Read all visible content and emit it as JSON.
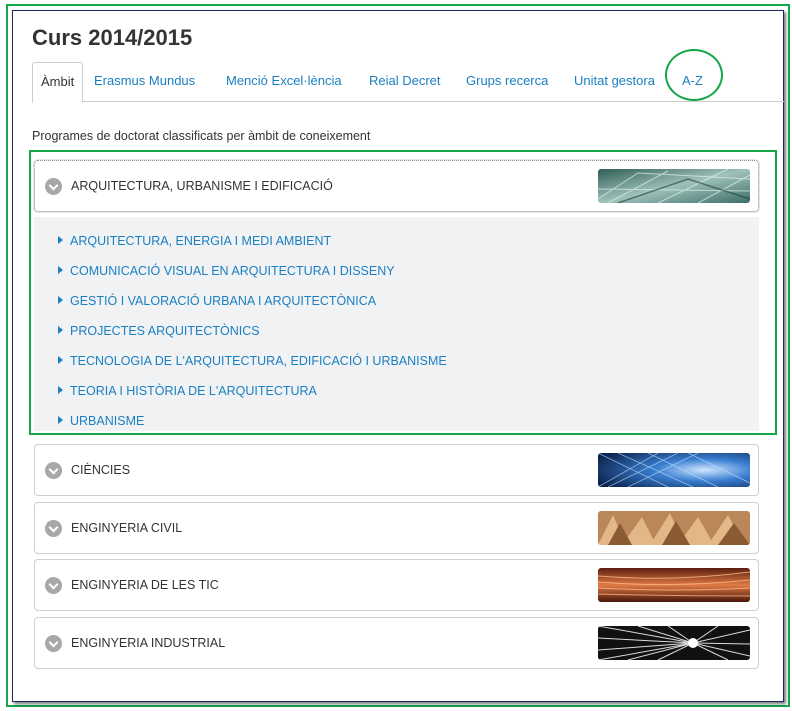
{
  "page": {
    "title": "Curs 2014/2015"
  },
  "tabs": [
    {
      "label": "Àmbit",
      "active": true
    },
    {
      "label": "Erasmus Mundus"
    },
    {
      "label": "Menció Excel·lència"
    },
    {
      "label": "Reial Decret"
    },
    {
      "label": "Grups recerca"
    },
    {
      "label": "Unitat gestora"
    },
    {
      "label": "A-Z"
    }
  ],
  "intro": "Programes de doctorat classificats per àmbit de coneixement",
  "areas": [
    {
      "label": "ARQUITECTURA, URBANISME I EDIFICACIÓ",
      "expanded": true,
      "thumb_icon": "architecture-glass-image",
      "programs": [
        "ARQUITECTURA, ENERGIA I MEDI AMBIENT",
        "COMUNICACIÓ VISUAL EN ARQUITECTURA I DISSENY",
        "GESTIÓ I VALORACIÓ URBANA I ARQUITECTÒNICA",
        "PROJECTES ARQUITECTÒNICS",
        "TECNOLOGIA DE L'ARQUITECTURA, EDIFICACIÓ I URBANISME",
        "TEORIA I HISTÒRIA DE L'ARQUITECTURA",
        "URBANISME"
      ]
    },
    {
      "label": "CIÈNCIES",
      "expanded": false,
      "thumb_icon": "blue-fractal-image"
    },
    {
      "label": "ENGINYERIA CIVIL",
      "expanded": false,
      "thumb_icon": "sand-dunes-image"
    },
    {
      "label": "ENGINYERIA DE LES TIC",
      "expanded": false,
      "thumb_icon": "copper-wires-image"
    },
    {
      "label": "ENGINYERIA INDUSTRIAL",
      "expanded": false,
      "thumb_icon": "light-burst-image"
    }
  ],
  "colors": {
    "link": "#1b7fc1",
    "highlight": "#16a64a",
    "expanded_body": "#f1f2f4"
  }
}
